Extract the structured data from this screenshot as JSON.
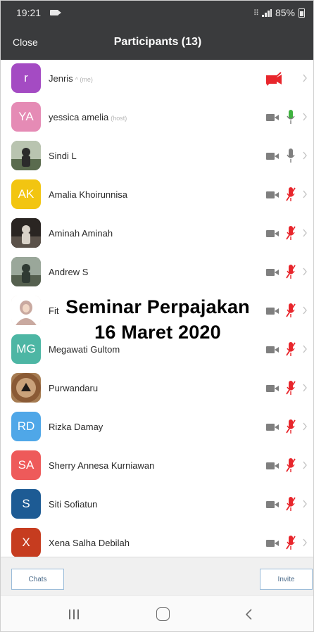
{
  "status_bar": {
    "time": "19:21",
    "sim": "⠿",
    "battery": "85%"
  },
  "header": {
    "close_label": "Close",
    "title": "Participants (13)"
  },
  "participants": [
    {
      "name": "Jenris",
      "tag": "^ (me)",
      "initials": "r",
      "color": "#a44bc3",
      "avatar_type": "initials",
      "video": "off-red",
      "mic": "none"
    },
    {
      "name": "yessica amelia",
      "tag": "(host)",
      "initials": "YA",
      "color": "#e58bb5",
      "avatar_type": "initials",
      "video": "on",
      "mic": "active-green"
    },
    {
      "name": "Sindi L",
      "tag": "",
      "initials": "",
      "color": "#8b8f7a",
      "avatar_type": "photo",
      "video": "on",
      "mic": "idle-gray"
    },
    {
      "name": "Amalia Khoirunnisa",
      "tag": "",
      "initials": "AK",
      "color": "#f2c511",
      "avatar_type": "initials",
      "video": "on",
      "mic": "muted"
    },
    {
      "name": "Aminah Aminah",
      "tag": "",
      "initials": "",
      "color": "#3b3530",
      "avatar_type": "photo",
      "video": "on",
      "mic": "muted"
    },
    {
      "name": "Andrew S",
      "tag": "",
      "initials": "",
      "color": "#6f7d6a",
      "avatar_type": "photo",
      "video": "on",
      "mic": "muted"
    },
    {
      "name": "Fit",
      "tag": "",
      "initials": "",
      "color": "#e8d9cf",
      "avatar_type": "photo",
      "video": "on",
      "mic": "muted"
    },
    {
      "name": "Megawati Gultom",
      "tag": "",
      "initials": "MG",
      "color": "#4db6a4",
      "avatar_type": "initials",
      "video": "on",
      "mic": "muted"
    },
    {
      "name": "Purwandaru",
      "tag": "",
      "initials": "",
      "color": "#a67c52",
      "avatar_type": "photo",
      "video": "on",
      "mic": "muted"
    },
    {
      "name": "Rizka Damay",
      "tag": "",
      "initials": "RD",
      "color": "#4fa7e8",
      "avatar_type": "initials",
      "video": "on",
      "mic": "muted"
    },
    {
      "name": "Sherry Annesa Kurniawan",
      "tag": "",
      "initials": "SA",
      "color": "#ee5a5a",
      "avatar_type": "initials",
      "video": "on",
      "mic": "muted"
    },
    {
      "name": "Siti Sofiatun",
      "tag": "",
      "initials": "S",
      "color": "#1d5b94",
      "avatar_type": "initials",
      "video": "on",
      "mic": "muted"
    },
    {
      "name": "Xena Salha Debilah",
      "tag": "",
      "initials": "X",
      "color": "#c63c1f",
      "avatar_type": "initials",
      "video": "on",
      "mic": "muted"
    }
  ],
  "overlay": {
    "line1": "Seminar Perpajakan",
    "line2": "16 Maret 2020"
  },
  "footer": {
    "chats_label": "Chats",
    "invite_label": "Invite"
  },
  "colors": {
    "bar_bg": "#3a3b3d",
    "mute_red": "#e8262c",
    "mic_green": "#3fb23f",
    "icon_gray": "#7f7f7f"
  }
}
